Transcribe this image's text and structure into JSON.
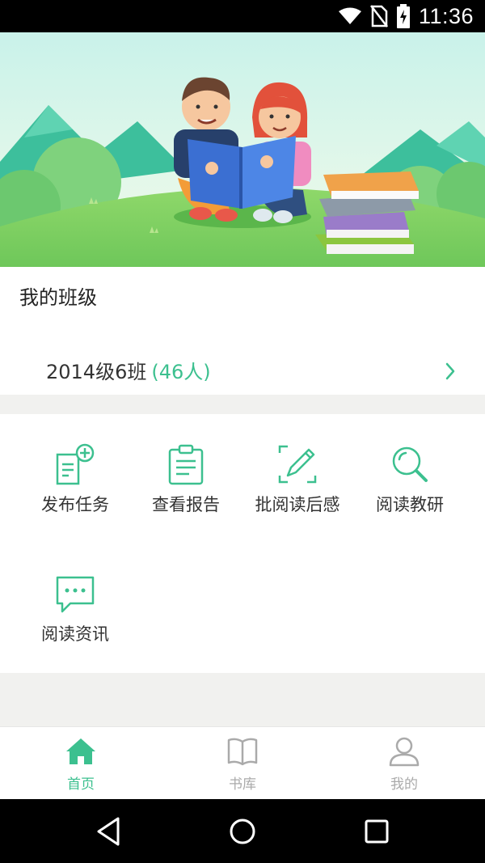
{
  "status_bar": {
    "time": "11:36",
    "icons": [
      "wifi-icon",
      "no-sim-icon",
      "battery-charging-icon"
    ]
  },
  "colors": {
    "accent": "#3cc08f",
    "muted": "#aaaaaa"
  },
  "my_class": {
    "title": "我的班级",
    "class_name": "2014级6班",
    "member_count": "(46人)"
  },
  "features": [
    {
      "label": "发布任务",
      "icon": "add-task-icon"
    },
    {
      "label": "查看报告",
      "icon": "clipboard-report-icon"
    },
    {
      "label": "批阅读后感",
      "icon": "edit-review-icon"
    },
    {
      "label": "阅读教研",
      "icon": "search-research-icon"
    },
    {
      "label": "阅读资讯",
      "icon": "chat-news-icon"
    }
  ],
  "bottom_nav": [
    {
      "label": "首页",
      "icon": "home-icon",
      "active": true
    },
    {
      "label": "书库",
      "icon": "book-icon",
      "active": false
    },
    {
      "label": "我的",
      "icon": "user-icon",
      "active": false
    }
  ]
}
